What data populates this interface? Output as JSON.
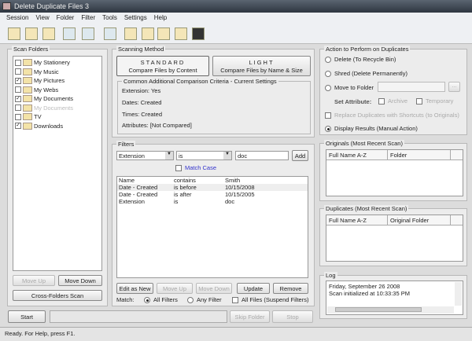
{
  "window": {
    "title": "Delete Duplicate Files 3"
  },
  "menu": [
    "Session",
    "View",
    "Folder",
    "Filter",
    "Tools",
    "Settings",
    "Help"
  ],
  "toolbar": [
    "add-folder-icon",
    "remove-folder-icon",
    "folder-properties-icon",
    "search-tool-icon",
    "compare-settings-icon",
    "scan-area-icon",
    "copy-files-icon",
    "move-files-icon",
    "film-icon",
    "disk-icon",
    "lock-icon"
  ],
  "scan_folders": {
    "label": "Scan Folders",
    "items": [
      {
        "name": "My Stationery",
        "checked": false
      },
      {
        "name": "My Music",
        "checked": false
      },
      {
        "name": "My Pictures",
        "checked": true
      },
      {
        "name": "My Webs",
        "checked": false
      },
      {
        "name": "My Documents",
        "checked": true
      },
      {
        "name": "My Documents",
        "checked": false,
        "disabled": true
      },
      {
        "name": "TV",
        "checked": false
      },
      {
        "name": "Downloads",
        "checked": true
      }
    ],
    "move_up": "Move Up",
    "move_down": "Move Down",
    "cross": "Cross-Folders Scan"
  },
  "scanning": {
    "label": "Scanning Method",
    "standard_title": "STANDARD",
    "standard_sub": "Compare Files by Content",
    "light_title": "LIGHT",
    "light_sub": "Compare Files by Name & Size",
    "criteria_label": "Common Additional Comparison Criteria - Current Settings",
    "extension": "Extension: Yes",
    "dates": "Dates: Created",
    "times": "Times: Created",
    "attributes": "Attributes:  [Not Compared]"
  },
  "filters": {
    "label": "Filters",
    "field": "Extension",
    "op": "is",
    "value": "doc",
    "add": "Add",
    "match_case": "Match Case",
    "rows": [
      [
        "Name",
        "contains",
        "Smith"
      ],
      [
        "Date - Created",
        "is before",
        "10/15/2008"
      ],
      [
        "Date - Created",
        "is after",
        "10/15/2005"
      ],
      [
        "Extension",
        "is",
        "doc"
      ]
    ],
    "edit_as_new": "Edit as New",
    "move_up": "Move Up",
    "move_down": "Move Down",
    "update": "Update",
    "remove": "Remove",
    "match_label": "Match:",
    "all_filters": "All Filters",
    "any_filter": "Any Filter",
    "all_files": "All Files (Suspend Filters)"
  },
  "action": {
    "label": "Action to Perform on Duplicates",
    "delete": "Delete (To Recycle Bin)",
    "shred": "Shred (Delete Permanently)",
    "move": "Move to Folder",
    "browse": "...",
    "set_attr": "Set Attribute:",
    "archive": "Archive",
    "temporary": "Temporary",
    "replace": "Replace Duplicates with Shortcuts (to Originals)",
    "display": "Display Results (Manual Action)",
    "selected": "display"
  },
  "originals": {
    "label": "Originals (Most Recent Scan)",
    "col1": "Full Name A-Z",
    "col2": "Folder"
  },
  "duplicates": {
    "label": "Duplicates (Most Recent Scan)",
    "col1": "Full Name A-Z",
    "col2": "Original Folder"
  },
  "log": {
    "label": "Log",
    "lines": [
      "Friday, September 26 2008",
      "Scan initialized at 10:33:35 PM"
    ]
  },
  "bottom": {
    "start": "Start",
    "skip": "Skip Folder",
    "stop": "Stop"
  },
  "status": "Ready. For Help, press F1."
}
